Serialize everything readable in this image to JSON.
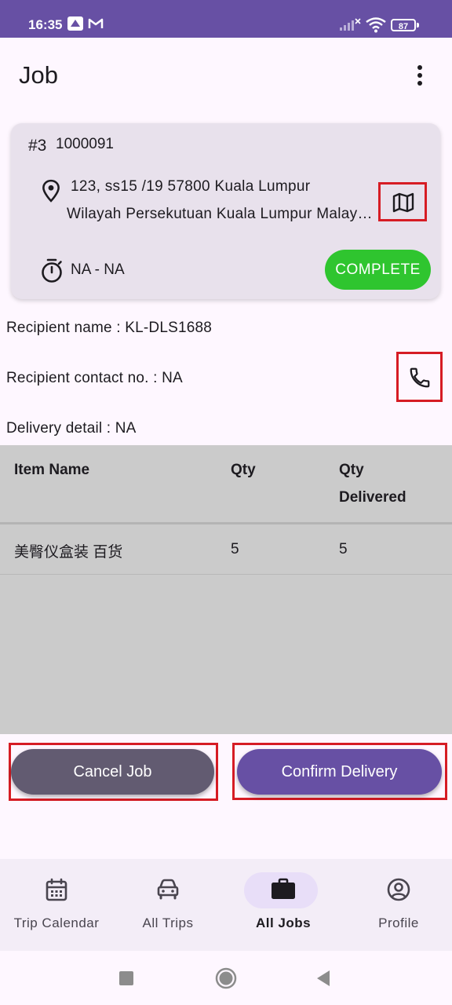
{
  "status_bar": {
    "time": "16:35",
    "battery": "87"
  },
  "app_bar": {
    "title": "Job"
  },
  "job_card": {
    "index": "#3",
    "code": "1000091",
    "address_line1": "123, ss15 /19 57800 Kuala Lumpur",
    "address_line2": "Wilayah Persekutuan Kuala Lumpur Malaysia",
    "time_range": "NA - NA",
    "status": "COMPLETE",
    "status_color": "#2fc52f"
  },
  "recipient": {
    "name_label": "Recipient name : KL-DLS1688",
    "contact_label": "Recipient contact no. : NA",
    "detail_label": "Delivery detail : NA"
  },
  "items_table": {
    "headers": {
      "name": "Item Name",
      "qty": "Qty",
      "delivered_line1": "Qty",
      "delivered_line2": "Delivered"
    },
    "rows": [
      {
        "name": "美臀仪盒装 百货",
        "qty": "5",
        "delivered": "5"
      }
    ]
  },
  "actions": {
    "cancel_label": "Cancel Job",
    "confirm_label": "Confirm Delivery",
    "cancel_color": "#625b71",
    "confirm_color": "#6750a4"
  },
  "bottom_nav": {
    "items": [
      {
        "label": "Trip Calendar",
        "icon": "calendar-icon"
      },
      {
        "label": "All Trips",
        "icon": "car-icon"
      },
      {
        "label": "All Jobs",
        "icon": "briefcase-icon",
        "active": true
      },
      {
        "label": "Profile",
        "icon": "account-circle-icon"
      }
    ]
  },
  "accent_color": "#6750a4"
}
